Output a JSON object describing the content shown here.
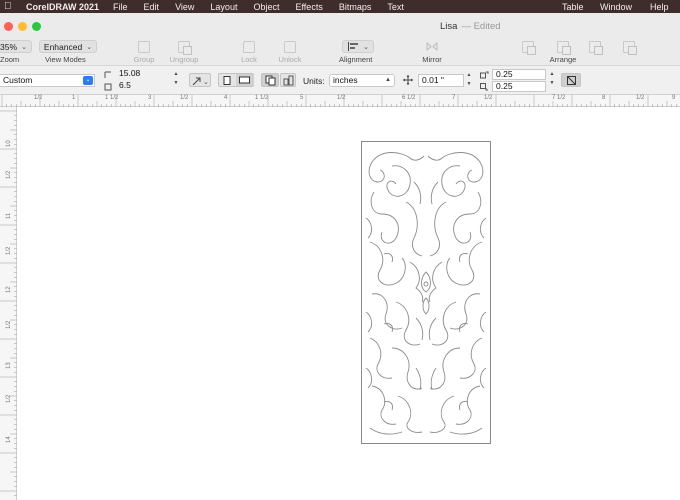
{
  "menubar": {
    "app_name": "CorelDRAW 2021",
    "menus": [
      "File",
      "Edit",
      "View",
      "Layout",
      "Object",
      "Effects",
      "Bitmaps",
      "Text"
    ],
    "right_menus": [
      "Table",
      "Window",
      "Help"
    ]
  },
  "window": {
    "title": "Lisa",
    "subtitle": "— Edited"
  },
  "toolbar": {
    "zoom_value": "35%",
    "zoom_label": "Zoom",
    "view_mode_value": "Enhanced",
    "view_mode_label": "View Modes",
    "group_label": "Group",
    "ungroup_label": "Ungroup",
    "lock_label": "Lock",
    "unlock_label": "Unlock",
    "alignment_label": "Alignment",
    "mirror_label": "Mirror",
    "arrange_label": "Arrange"
  },
  "propbar": {
    "page_size": "Custom",
    "width": "15.08",
    "height": "6.5",
    "units_label": "Units:",
    "units_value": "inches",
    "nudge_value": "0.01 \"",
    "dup_x": "0.25",
    "dup_y": "0.25"
  },
  "ruler": {
    "top_labels": [
      "1/2",
      "1",
      "1 1/2",
      "3",
      "1/2",
      "4",
      "1 1/2",
      "5",
      "1/2",
      "6 1/2",
      "7",
      "1/2",
      "7 1/2",
      "8",
      "1/2",
      "9"
    ],
    "left_labels": [
      "10",
      "1/2",
      "11",
      "1/2",
      "12",
      "1/2",
      "13",
      "1/2",
      "14"
    ]
  },
  "colors": {
    "menubar_bg": "#3f2c2c",
    "close": "#fe5f57",
    "minimize": "#febc2e",
    "zoom": "#28c840",
    "units_accent": "#2b7cf6"
  }
}
